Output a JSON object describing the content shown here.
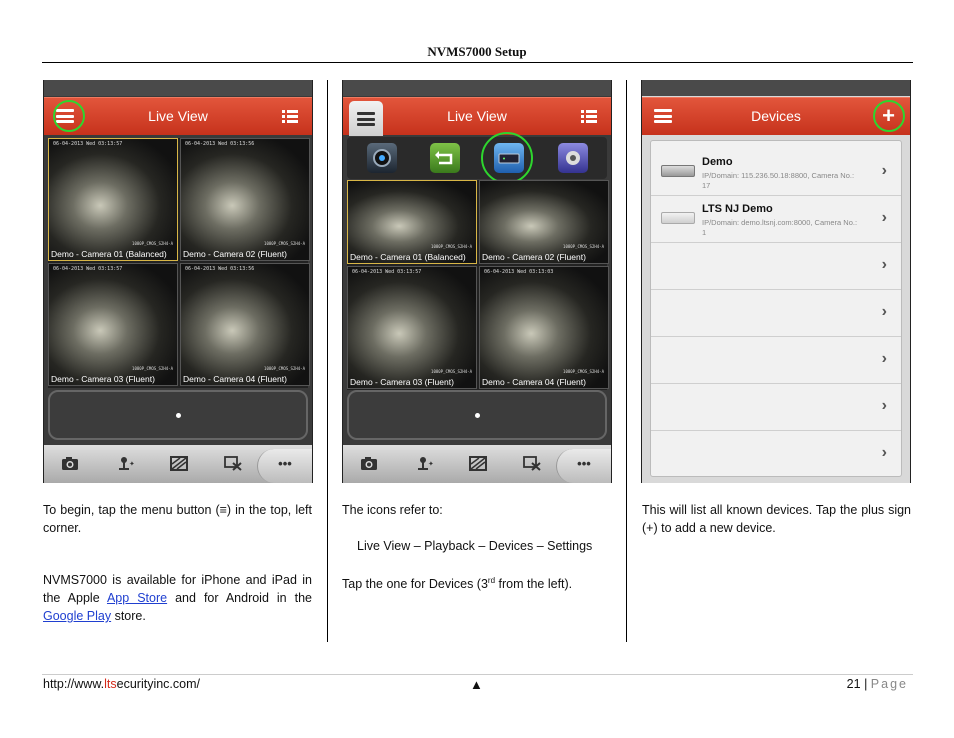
{
  "header": {
    "title": "NVMS7000 Setup"
  },
  "panels": {
    "live1": {
      "title": "Live View",
      "cameras": [
        {
          "label": "Demo - Camera 01 (Balanced)",
          "timestamp": "06-04-2013 Wed 03:13:57",
          "cam_id": "1080P_CMOS_S2H4-A"
        },
        {
          "label": "Demo - Camera 02 (Fluent)",
          "timestamp": "06-04-2013 Wed 03:13:56",
          "cam_id": "1080P_CMOS_S2H4-A"
        },
        {
          "label": "Demo - Camera 03 (Fluent)",
          "timestamp": "06-04-2013 Wed 03:13:57",
          "cam_id": "1080P_CMOS_S2H4-A"
        },
        {
          "label": "Demo - Camera 04 (Fluent)",
          "timestamp": "06-04-2013 Wed 03:13:56",
          "cam_id": "1080P_CMOS_S2H4-A"
        }
      ]
    },
    "live2": {
      "title": "Live View",
      "cameras": [
        {
          "label": "Demo - Camera 01 (Balanced)",
          "timestamp": "06-04-2013 Wed 03:13:57",
          "cam_id": "1080P_CMOS_S2H4-A"
        },
        {
          "label": "Demo - Camera 02 (Fluent)",
          "timestamp": "06-04-2013 Wed 03:13:03",
          "cam_id": "1080P_CMOS_S2H4-A"
        },
        {
          "label": "Demo - Camera 03 (Fluent)",
          "timestamp": "06-04-2013 Wed 03:13:57",
          "cam_id": "1080P_CMOS_S2H4-A"
        },
        {
          "label": "Demo - Camera 04 (Fluent)",
          "timestamp": "06-04-2013 Wed 03:13:03",
          "cam_id": "1080P_CMOS_S2H4-A"
        }
      ]
    },
    "devices": {
      "title": "Devices",
      "items": [
        {
          "name": "Demo",
          "info": "IP/Domain: 115.236.50.18:8800, Camera No.: 17"
        },
        {
          "name": "LTS NJ Demo",
          "info": "IP/Domain: demo.ltsnj.com:8000, Camera No.: 1"
        }
      ]
    }
  },
  "columns": {
    "col1": {
      "para1": "To begin, tap the menu button (≡) in the top, left corner.",
      "para2_prefix": "NVMS7000 is available for iPhone and iPad in the Apple ",
      "link_app_store": "App Store",
      "para2_mid": " and for Android in the ",
      "link_google_play": "Google Play",
      "para2_suffix": " store."
    },
    "col2": {
      "para1": "The icons refer to:",
      "para2": "Live View – Playback – Devices – Settings",
      "para3_prefix": "Tap the one for Devices (3",
      "para3_sup": "rd",
      "para3_suffix": " from the left)."
    },
    "col3": {
      "para1": "This will list all known devices.  Tap the plus sign (+) to add a new device."
    }
  },
  "footer": {
    "url_prefix": "http://www.",
    "url_highlight": "lts",
    "url_suffix": "ecurityinc.com/",
    "arrow": "▲",
    "page_number": "21",
    "separator": "|",
    "page_word": "Page"
  }
}
